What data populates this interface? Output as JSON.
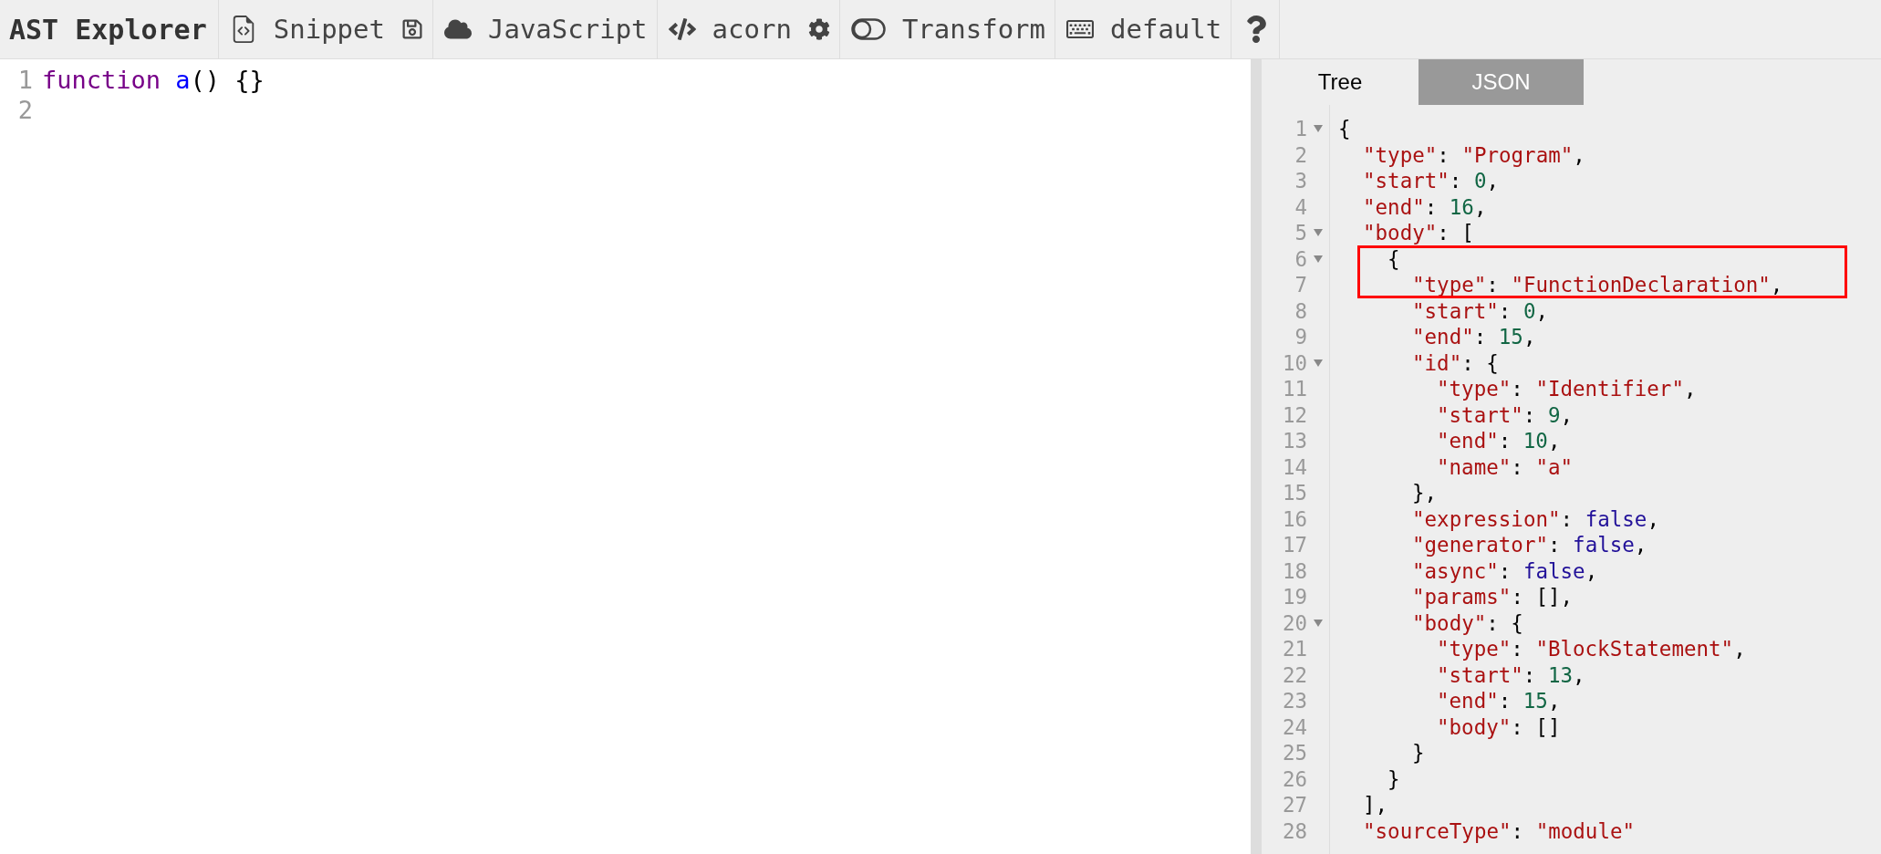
{
  "toolbar": {
    "title": "AST Explorer",
    "items": [
      {
        "kind": "menu",
        "label": "Snippet"
      },
      {
        "kind": "menu",
        "label": "JavaScript"
      },
      {
        "kind": "menu",
        "label": "acorn"
      },
      {
        "kind": "toggle",
        "label": "Transform",
        "on": false
      },
      {
        "kind": "menu",
        "label": "default"
      },
      {
        "kind": "help"
      }
    ]
  },
  "editor": {
    "lines": [
      {
        "number": "1",
        "tokens": [
          {
            "kind": "keyword",
            "text": "function"
          },
          {
            "kind": "def",
            "text": "a"
          },
          {
            "kind": "punct",
            "text": "() {}"
          }
        ]
      },
      {
        "number": "2"
      }
    ]
  },
  "output": {
    "tabs": [
      {
        "label": "Tree",
        "selected": false
      },
      {
        "label": "JSON",
        "selected": true
      }
    ],
    "highlight": {
      "kind": "rectangle",
      "color": "#ff0000"
    },
    "lines": [
      {
        "number": "1",
        "fold": true,
        "tokens": [
          {
            "kind": "punct",
            "text": "{"
          }
        ]
      },
      {
        "number": "2",
        "fold": false,
        "tokens": [
          {
            "kind": "key",
            "text": "\"type\""
          },
          {
            "kind": "punct",
            "text": ": "
          },
          {
            "kind": "string",
            "text": "\"Program\""
          },
          {
            "kind": "punct",
            "text": ","
          }
        ]
      },
      {
        "number": "3",
        "fold": false,
        "tokens": [
          {
            "kind": "key",
            "text": "\"start\""
          },
          {
            "kind": "punct",
            "text": ": "
          },
          {
            "kind": "number",
            "text": "0"
          },
          {
            "kind": "punct",
            "text": ","
          }
        ]
      },
      {
        "number": "4",
        "fold": false,
        "tokens": [
          {
            "kind": "key",
            "text": "\"end\""
          },
          {
            "kind": "punct",
            "text": ": "
          },
          {
            "kind": "number",
            "text": "16"
          },
          {
            "kind": "punct",
            "text": ","
          }
        ]
      },
      {
        "number": "5",
        "fold": true,
        "tokens": [
          {
            "kind": "key",
            "text": "\"body\""
          },
          {
            "kind": "punct",
            "text": ": ["
          }
        ]
      },
      {
        "number": "6",
        "fold": true,
        "tokens": [
          {
            "kind": "punct",
            "text": "{"
          }
        ]
      },
      {
        "number": "7",
        "fold": false,
        "tokens": [
          {
            "kind": "key",
            "text": "\"type\""
          },
          {
            "kind": "punct",
            "text": ": "
          },
          {
            "kind": "string",
            "text": "\"FunctionDeclaration\""
          },
          {
            "kind": "punct",
            "text": ","
          }
        ]
      },
      {
        "number": "8",
        "fold": false,
        "tokens": [
          {
            "kind": "key",
            "text": "\"start\""
          },
          {
            "kind": "punct",
            "text": ": "
          },
          {
            "kind": "number",
            "text": "0"
          },
          {
            "kind": "punct",
            "text": ","
          }
        ]
      },
      {
        "number": "9",
        "fold": false,
        "tokens": [
          {
            "kind": "key",
            "text": "\"end\""
          },
          {
            "kind": "punct",
            "text": ": "
          },
          {
            "kind": "number",
            "text": "15"
          },
          {
            "kind": "punct",
            "text": ","
          }
        ]
      },
      {
        "number": "10",
        "fold": true,
        "tokens": [
          {
            "kind": "key",
            "text": "\"id\""
          },
          {
            "kind": "punct",
            "text": ": {"
          }
        ]
      },
      {
        "number": "11",
        "fold": false,
        "tokens": [
          {
            "kind": "key",
            "text": "\"type\""
          },
          {
            "kind": "punct",
            "text": ": "
          },
          {
            "kind": "string",
            "text": "\"Identifier\""
          },
          {
            "kind": "punct",
            "text": ","
          }
        ]
      },
      {
        "number": "12",
        "fold": false,
        "tokens": [
          {
            "kind": "key",
            "text": "\"start\""
          },
          {
            "kind": "punct",
            "text": ": "
          },
          {
            "kind": "number",
            "text": "9"
          },
          {
            "kind": "punct",
            "text": ","
          }
        ]
      },
      {
        "number": "13",
        "fold": false,
        "tokens": [
          {
            "kind": "key",
            "text": "\"end\""
          },
          {
            "kind": "punct",
            "text": ": "
          },
          {
            "kind": "number",
            "text": "10"
          },
          {
            "kind": "punct",
            "text": ","
          }
        ]
      },
      {
        "number": "14",
        "fold": false,
        "tokens": [
          {
            "kind": "key",
            "text": "\"name\""
          },
          {
            "kind": "punct",
            "text": ": "
          },
          {
            "kind": "string",
            "text": "\"a\""
          }
        ]
      },
      {
        "number": "15",
        "fold": false,
        "tokens": [
          {
            "kind": "punct",
            "text": "},"
          }
        ]
      },
      {
        "number": "16",
        "fold": false,
        "tokens": [
          {
            "kind": "key",
            "text": "\"expression\""
          },
          {
            "kind": "punct",
            "text": ": "
          },
          {
            "kind": "boolean",
            "text": "false"
          },
          {
            "kind": "punct",
            "text": ","
          }
        ]
      },
      {
        "number": "17",
        "fold": false,
        "tokens": [
          {
            "kind": "key",
            "text": "\"generator\""
          },
          {
            "kind": "punct",
            "text": ": "
          },
          {
            "kind": "boolean",
            "text": "false"
          },
          {
            "kind": "punct",
            "text": ","
          }
        ]
      },
      {
        "number": "18",
        "fold": false,
        "tokens": [
          {
            "kind": "key",
            "text": "\"async\""
          },
          {
            "kind": "punct",
            "text": ": "
          },
          {
            "kind": "boolean",
            "text": "false"
          },
          {
            "kind": "punct",
            "text": ","
          }
        ]
      },
      {
        "number": "19",
        "fold": false,
        "tokens": [
          {
            "kind": "key",
            "text": "\"params\""
          },
          {
            "kind": "punct",
            "text": ": [],"
          }
        ]
      },
      {
        "number": "20",
        "fold": true,
        "tokens": [
          {
            "kind": "key",
            "text": "\"body\""
          },
          {
            "kind": "punct",
            "text": ": {"
          }
        ]
      },
      {
        "number": "21",
        "fold": false,
        "tokens": [
          {
            "kind": "key",
            "text": "\"type\""
          },
          {
            "kind": "punct",
            "text": ": "
          },
          {
            "kind": "string",
            "text": "\"BlockStatement\""
          },
          {
            "kind": "punct",
            "text": ","
          }
        ]
      },
      {
        "number": "22",
        "fold": false,
        "tokens": [
          {
            "kind": "key",
            "text": "\"start\""
          },
          {
            "kind": "punct",
            "text": ": "
          },
          {
            "kind": "number",
            "text": "13"
          },
          {
            "kind": "punct",
            "text": ","
          }
        ]
      },
      {
        "number": "23",
        "fold": false,
        "tokens": [
          {
            "kind": "key",
            "text": "\"end\""
          },
          {
            "kind": "punct",
            "text": ": "
          },
          {
            "kind": "number",
            "text": "15"
          },
          {
            "kind": "punct",
            "text": ","
          }
        ]
      },
      {
        "number": "24",
        "fold": false,
        "tokens": [
          {
            "kind": "key",
            "text": "\"body\""
          },
          {
            "kind": "punct",
            "text": ": []"
          }
        ]
      },
      {
        "number": "25",
        "fold": false,
        "tokens": [
          {
            "kind": "punct",
            "text": "}"
          }
        ]
      },
      {
        "number": "26",
        "fold": false,
        "tokens": [
          {
            "kind": "punct",
            "text": "}"
          }
        ]
      },
      {
        "number": "27",
        "fold": false,
        "tokens": [
          {
            "kind": "punct",
            "text": "],"
          }
        ]
      },
      {
        "number": "28",
        "fold": false,
        "tokens": [
          {
            "kind": "key",
            "text": "\"sourceType\""
          },
          {
            "kind": "punct",
            "text": ": "
          },
          {
            "kind": "string",
            "text": "\"module\""
          }
        ]
      }
    ]
  }
}
